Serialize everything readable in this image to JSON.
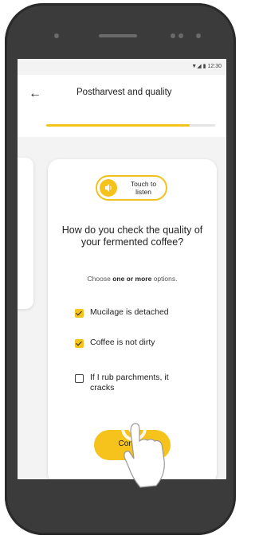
{
  "status_bar": {
    "time": "12:30"
  },
  "app_bar": {
    "title": "Postharvest and quality",
    "back_label": "←"
  },
  "progress": {
    "fraction": 0.85
  },
  "listen_button": {
    "text": "Touch to listen"
  },
  "question": "How do you check the quality of your fermented coffee?",
  "hint": {
    "prefix": "Choose ",
    "emphasis": "one or more",
    "suffix": " options."
  },
  "options": [
    {
      "label": "Mucilage is detached",
      "checked": true
    },
    {
      "label": "Coffee is not dirty",
      "checked": true
    },
    {
      "label": "If I rub parchments, it cracks",
      "checked": false
    }
  ],
  "confirm_button": {
    "label": "Confirm"
  },
  "colors": {
    "accent": "#f6c21c",
    "phone": "#3b3b3b",
    "screen_bg": "#f3f3f3"
  },
  "icons": [
    "back-arrow-icon",
    "speaker-wave-icon",
    "checkbox-icon",
    "hand-pointer-icon",
    "signal-icon",
    "battery-icon"
  ]
}
